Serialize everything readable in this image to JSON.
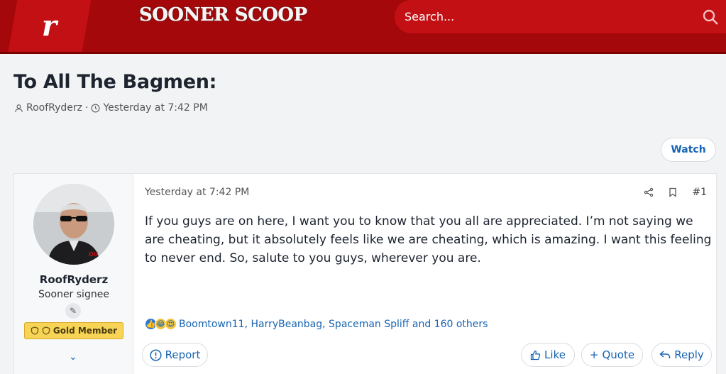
{
  "header": {
    "logo_letter": "r",
    "site_name": "SOONER SCOOP",
    "search_placeholder": "Search..."
  },
  "thread": {
    "title": "To All The Bagmen:",
    "author": "RoofRyderz",
    "separator": "·",
    "time": "Yesterday at 7:42 PM",
    "watch_label": "Watch"
  },
  "post": {
    "user": {
      "name": "RoofRyderz",
      "title": "Sooner signee",
      "badge": "Gold Member"
    },
    "date": "Yesterday at 7:42 PM",
    "number": "#1",
    "body": "If you guys are on here, I want you to know that you all are appreciated. I’m not saying we are cheating, but it absolutely feels like we are cheating, which is amazing. I want this feeling to never end. So, salute to you guys, wherever you are.",
    "reactions_text": "Boomtown11, HarryBeanbag, Spaceman Spliff and 160 others",
    "buttons": {
      "report": "Report",
      "like": "Like",
      "quote": "Quote",
      "reply": "Reply"
    }
  },
  "colors": {
    "header_red": "#a5080b",
    "search_red": "#c21014",
    "link_blue": "#1764b3",
    "gold": "#f7d455"
  }
}
